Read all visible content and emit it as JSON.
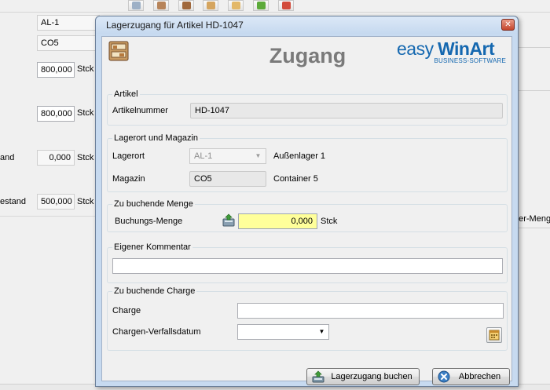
{
  "background": {
    "fields": [
      {
        "value": "AL-1"
      },
      {
        "value": "CO5"
      },
      {
        "value": "800,000",
        "unit": "Stck"
      },
      {
        "value": "800,000",
        "unit": "Stck"
      },
      {
        "label": "and",
        "value": "0,000",
        "unit": "Stck"
      },
      {
        "label": "estand",
        "value": "500,000",
        "unit": "Stck"
      }
    ],
    "right_text": "ger-Meng"
  },
  "dialog": {
    "title": "Lagerzugang für Artikel HD-1047",
    "close_symbol": "✕",
    "heading": "Zugang",
    "logo": {
      "easy": "easy",
      "win": "WinArt",
      "sub": "BUSINESS-SOFTWARE"
    },
    "artikel": {
      "group_title": "Artikel",
      "label": "Artikelnummer",
      "value": "HD-1047"
    },
    "lagerort": {
      "group_title": "Lagerort und Magazin",
      "lagerort_label": "Lagerort",
      "lagerort_value": "AL-1",
      "lagerort_desc": "Außenlager 1",
      "magazin_label": "Magazin",
      "magazin_value": "CO5",
      "magazin_desc": "Container 5"
    },
    "menge": {
      "group_title": "Zu buchende Menge",
      "label": "Buchungs-Menge",
      "value": "0,000",
      "unit": "Stck"
    },
    "kommentar": {
      "group_title": "Eigener Kommentar",
      "value": ""
    },
    "charge": {
      "group_title": "Zu buchende Charge",
      "charge_label": "Charge",
      "charge_value": "",
      "date_label": "Chargen-Verfallsdatum",
      "date_value": ""
    },
    "buttons": {
      "book": "Lagerzugang buchen",
      "cancel": "Abbrechen"
    }
  },
  "colors": {
    "title_bar": "#c6d9ef",
    "heading": "#7a7a7a",
    "logo": "#1568b0",
    "quantity_field": "#ffff9a"
  }
}
